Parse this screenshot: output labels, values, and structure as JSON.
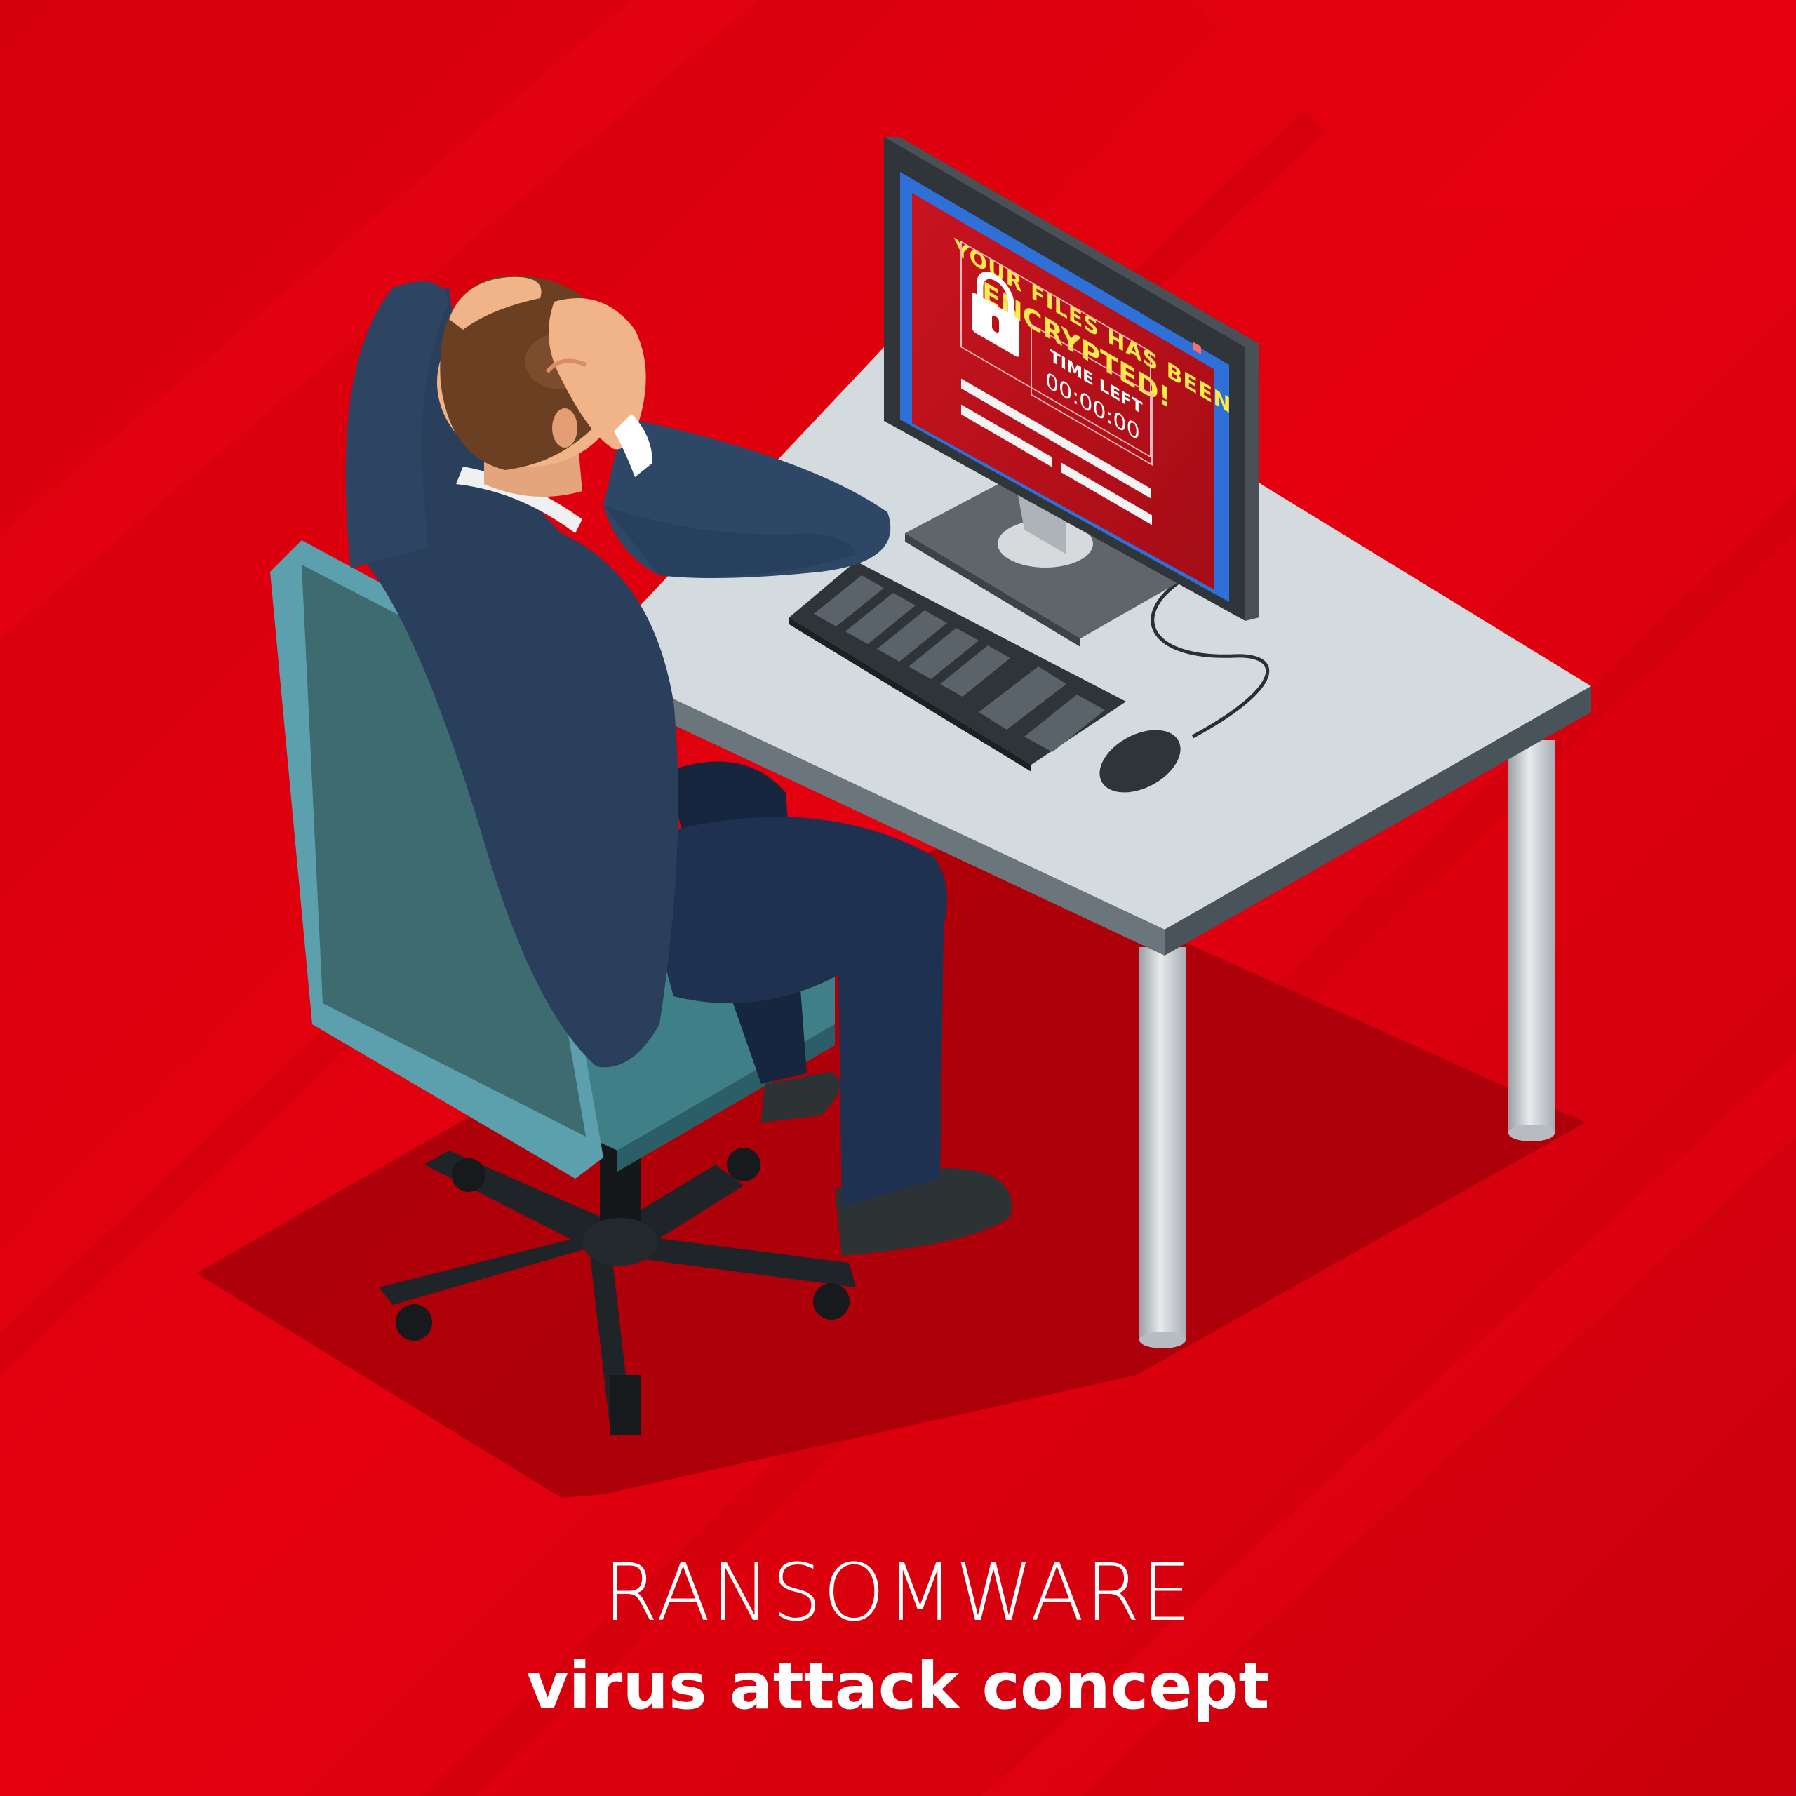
{
  "scene": {
    "background_color": "#d90010",
    "accent_yellow": "#ffe94a",
    "screen_red": "#b8101c"
  },
  "screen": {
    "line1": "YOUR FILES HAS BEEN",
    "line2": "ENCRYPTED!",
    "time_label": "TIME LEFT",
    "time_value": "00:00:00",
    "lock_icon": "padlock-icon"
  },
  "caption": {
    "headline": "RANSOMWARE",
    "subline": "virus attack concept"
  }
}
